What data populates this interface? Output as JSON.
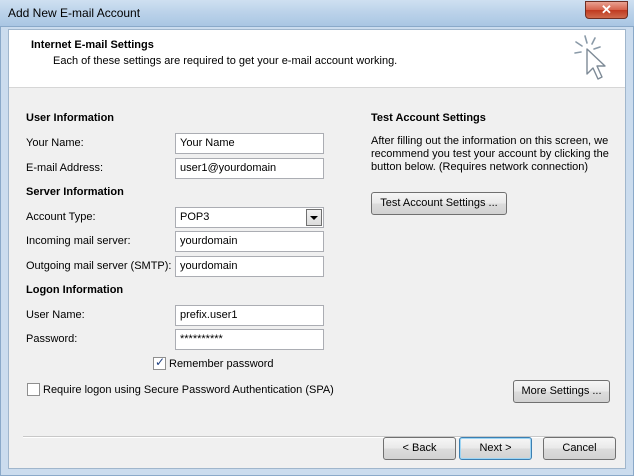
{
  "window": {
    "title": "Add New E-mail Account",
    "close_glyph": "✕"
  },
  "header": {
    "title": "Internet E-mail Settings",
    "subtitle": "Each of these settings are required to get your e-mail account working.",
    "icon": "cursor-click-icon"
  },
  "user_info": {
    "title": "User Information",
    "your_name_label": "Your Name:",
    "your_name_value": "Your Name",
    "email_label": "E-mail Address:",
    "email_value": "user1@yourdomain"
  },
  "server_info": {
    "title": "Server Information",
    "account_type_label": "Account Type:",
    "account_type_value": "POP3",
    "incoming_label": "Incoming mail server:",
    "incoming_value": "yourdomain",
    "outgoing_label": "Outgoing mail server (SMTP):",
    "outgoing_value": "yourdomain"
  },
  "logon_info": {
    "title": "Logon Information",
    "username_label": "User Name:",
    "username_value": "prefix.user1",
    "password_label": "Password:",
    "password_value": "**********",
    "remember_label": "Remember password",
    "remember_checked": true,
    "spa_label": "Require logon using Secure Password Authentication (SPA)",
    "spa_checked": false
  },
  "test_settings": {
    "title": "Test Account Settings",
    "description": "After filling out the information on this screen, we recommend you test your account by clicking the button below. (Requires network connection)",
    "button_label": "Test Account Settings ..."
  },
  "more_settings_label": "More Settings ...",
  "footer": {
    "back_label": "< Back",
    "next_label": "Next >",
    "cancel_label": "Cancel"
  }
}
